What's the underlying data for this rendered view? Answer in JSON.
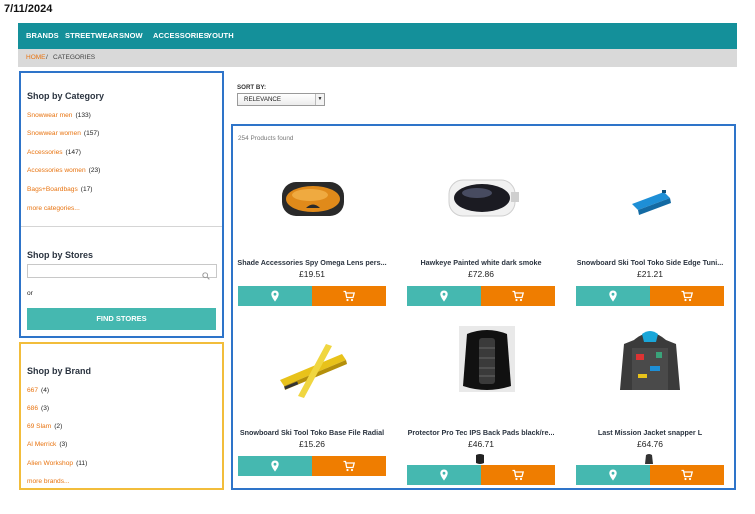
{
  "date": "7/11/2024",
  "nav": {
    "items": [
      "BRANDS",
      "STREETWEAR",
      "SNOW",
      "ACCESSORIES",
      "YOUTH"
    ]
  },
  "breadcrumb": {
    "home": "HOME",
    "separator": "/",
    "current": "CATEGORIES"
  },
  "category_panel": {
    "title": "Shop by Category",
    "items": [
      {
        "label": "Snowwear men",
        "count": "(133)"
      },
      {
        "label": "Snowwear women",
        "count": "(157)"
      },
      {
        "label": "Accessories",
        "count": "(147)"
      },
      {
        "label": "Accessories women",
        "count": "(23)"
      },
      {
        "label": "Bags+Boardbags",
        "count": "(17)"
      }
    ],
    "more": "more categories..."
  },
  "stores_panel": {
    "title": "Shop by Stores",
    "search_placeholder": "",
    "or_text": "or",
    "find_button": "FIND STORES"
  },
  "brand_panel": {
    "title": "Shop by Brand",
    "items": [
      {
        "label": "667",
        "count": "(4)"
      },
      {
        "label": "686",
        "count": "(3)"
      },
      {
        "label": "69 Slam",
        "count": "(2)"
      },
      {
        "label": "Al Merrick",
        "count": "(3)"
      },
      {
        "label": "Alien Workshop",
        "count": "(11)"
      }
    ],
    "more": "more brands..."
  },
  "sort": {
    "label": "SORT BY:",
    "selected": "RELEVANCE"
  },
  "products": {
    "found_text": "254 Products found",
    "items": [
      {
        "name": "Shade Accessories Spy Omega Lens pers...",
        "price": "£19.51"
      },
      {
        "name": "Hawkeye Painted white dark smoke",
        "price": "£72.86"
      },
      {
        "name": "Snowboard Ski Tool Toko Side Edge Tuni...",
        "price": "£21.21"
      },
      {
        "name": "Snowboard Ski Tool Toko Base File Radial",
        "price": "£15.26"
      },
      {
        "name": "Protector Pro Tec IPS Back Pads black/re...",
        "price": "£46.71"
      },
      {
        "name": "Last Mission Jacket snapper L",
        "price": "£64.76"
      }
    ]
  },
  "colors": {
    "nav": "#14909a",
    "accent_orange": "#ef7d00",
    "accent_teal": "#45b8b0",
    "link": "#e8730f",
    "panel_blue": "#2e74c9",
    "panel_yellow": "#f2bd3b"
  },
  "icons": {
    "map": "map-marker-icon",
    "cart": "shopping-cart-icon",
    "search": "search-icon",
    "dropdown": "chevron-down-icon"
  }
}
